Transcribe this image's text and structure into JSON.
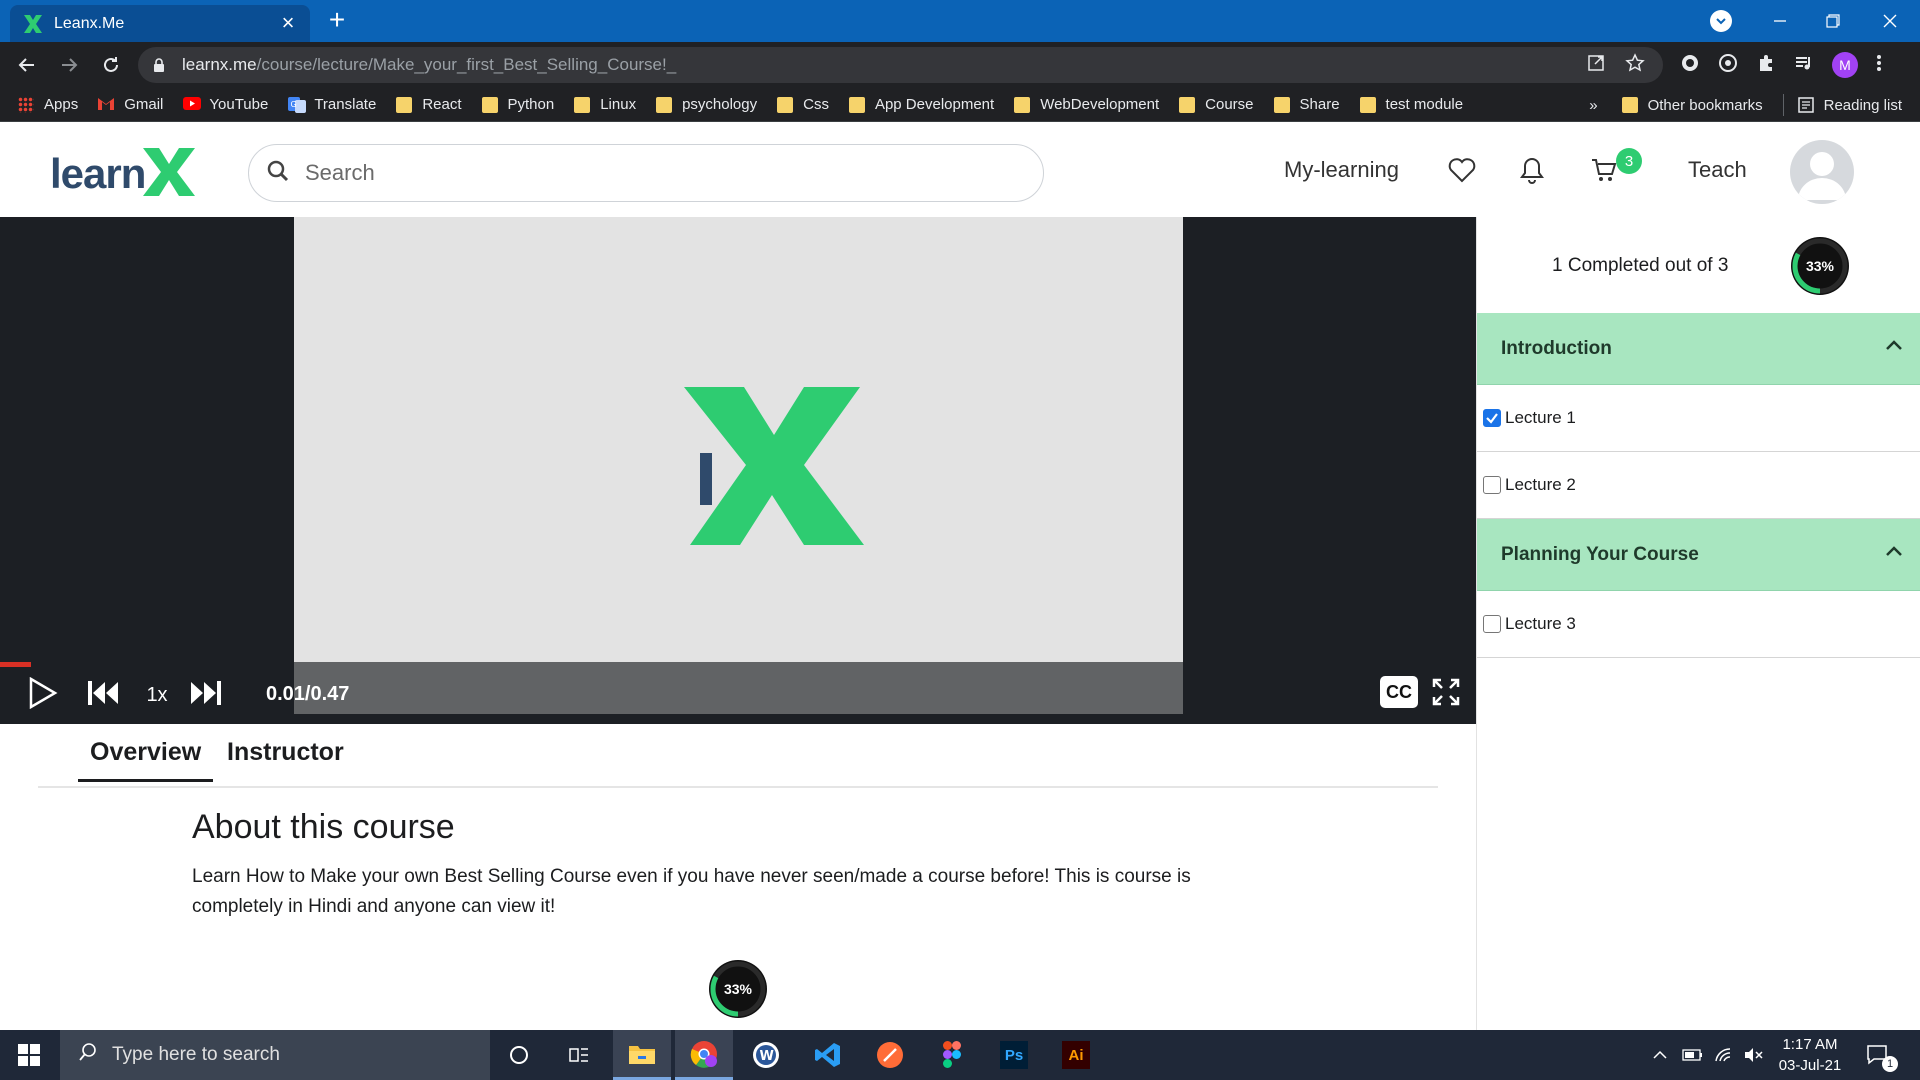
{
  "browser": {
    "tab_title": "Leanx.Me",
    "tab_close": "×",
    "new_tab": "+",
    "url_host": "learnx.me",
    "url_path": "/course/lecture/Make_your_first_Best_Selling_Course!_",
    "profile_initial": "M"
  },
  "bookmarks": {
    "items": [
      {
        "label": "Apps",
        "icon": "apps-grid-icon"
      },
      {
        "label": "Gmail",
        "icon": "gmail-icon"
      },
      {
        "label": "YouTube",
        "icon": "youtube-icon"
      },
      {
        "label": "Translate",
        "icon": "translate-icon"
      },
      {
        "label": "React",
        "icon": "folder-icon"
      },
      {
        "label": "Python",
        "icon": "folder-icon"
      },
      {
        "label": "Linux",
        "icon": "folder-icon"
      },
      {
        "label": "psychology",
        "icon": "folder-icon"
      },
      {
        "label": "Css",
        "icon": "folder-icon"
      },
      {
        "label": "App Development",
        "icon": "folder-icon"
      },
      {
        "label": "WebDevelopment",
        "icon": "folder-icon"
      },
      {
        "label": "Course",
        "icon": "folder-icon"
      },
      {
        "label": "Share",
        "icon": "folder-icon"
      },
      {
        "label": "test module",
        "icon": "folder-icon"
      }
    ],
    "overflow": "»",
    "other": "Other bookmarks",
    "reading_list": "Reading list"
  },
  "site": {
    "logo_text": "learn",
    "logo_x": "X",
    "search_placeholder": "Search",
    "nav_my_learning": "My-learning",
    "nav_teach": "Teach",
    "cart_count": "3"
  },
  "player": {
    "speed": "1x",
    "time": "0.01/0.47",
    "cc": "CC",
    "progress_fraction": 0.021
  },
  "content": {
    "tabs": [
      "Overview",
      "Instructor"
    ],
    "active_tab": "Overview",
    "about_title": "About this course",
    "about_text": "Learn How to Make your own Best Selling Course even if you have never seen/made a course before! This is course is completely in Hindi and anyone can view it!",
    "progress_label": "33%",
    "progress_fraction": 0.33
  },
  "sidebar": {
    "completed_text": "1 Completed out of 3",
    "progress_label": "33%",
    "progress_fraction": 0.33,
    "sections": [
      {
        "title": "Introduction",
        "lectures": [
          {
            "label": "Lecture 1",
            "checked": true
          },
          {
            "label": "Lecture 2",
            "checked": false
          }
        ]
      },
      {
        "title": "Planning Your Course",
        "lectures": [
          {
            "label": "Lecture 3",
            "checked": false
          }
        ]
      }
    ]
  },
  "taskbar": {
    "search_placeholder": "Type here to search",
    "time": "1:17 AM",
    "date": "03-Jul-21",
    "notification_count": "1",
    "apps": [
      "cortana-icon",
      "task-view-icon",
      "file-explorer-icon",
      "chrome-icon",
      "word-icon",
      "vscode-icon",
      "postman-icon",
      "figma-icon",
      "photoshop-icon",
      "illustrator-icon"
    ],
    "ps_label": "Ps",
    "ai_label": "Ai"
  },
  "colors": {
    "brand_green": "#2ecc71",
    "section_bg": "#a8e6c0",
    "chrome_blue": "#0b63b6"
  }
}
